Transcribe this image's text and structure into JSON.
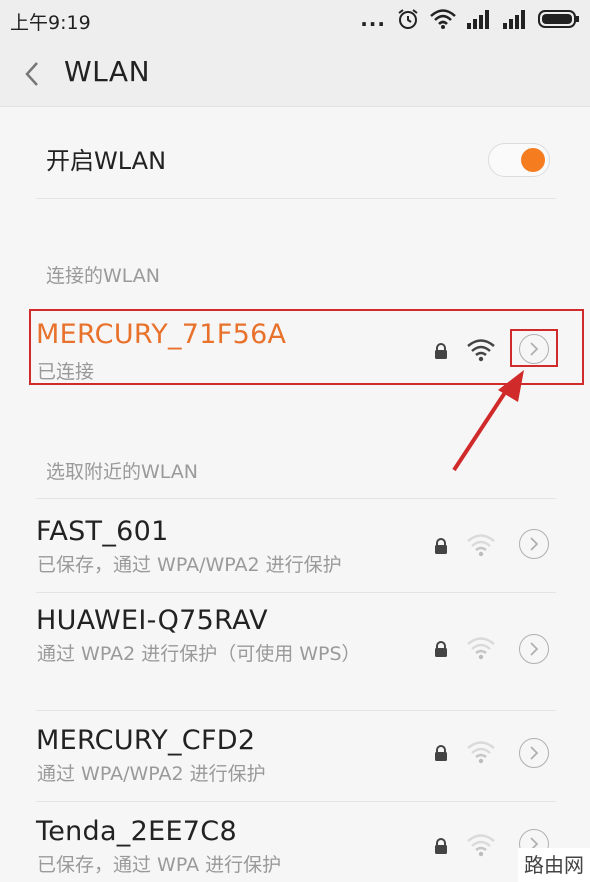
{
  "status_bar": {
    "time": "上午9:19",
    "dots": "..."
  },
  "header": {
    "title": "WLAN"
  },
  "toggle": {
    "label": "开启WLAN",
    "on": true
  },
  "connected": {
    "section_label": "连接的WLAN",
    "name": "MERCURY_71F56A",
    "status": "已连接"
  },
  "nearby": {
    "section_label": "选取附近的WLAN",
    "networks": [
      {
        "name": "FAST_601",
        "desc": "已保存，通过 WPA/WPA2 进行保护"
      },
      {
        "name": "HUAWEI-Q75RAV",
        "desc": "通过 WPA2 进行保护（可使用 WPS）"
      },
      {
        "name": "MERCURY_CFD2",
        "desc": "通过 WPA/WPA2 进行保护"
      },
      {
        "name": "Tenda_2EE7C8",
        "desc": "已保存，通过 WPA 进行保护"
      }
    ]
  },
  "watermark": "路由网",
  "colors": {
    "accent": "#f57c1f",
    "annotation": "#d02a2a",
    "connected_name": "#e8722c"
  }
}
